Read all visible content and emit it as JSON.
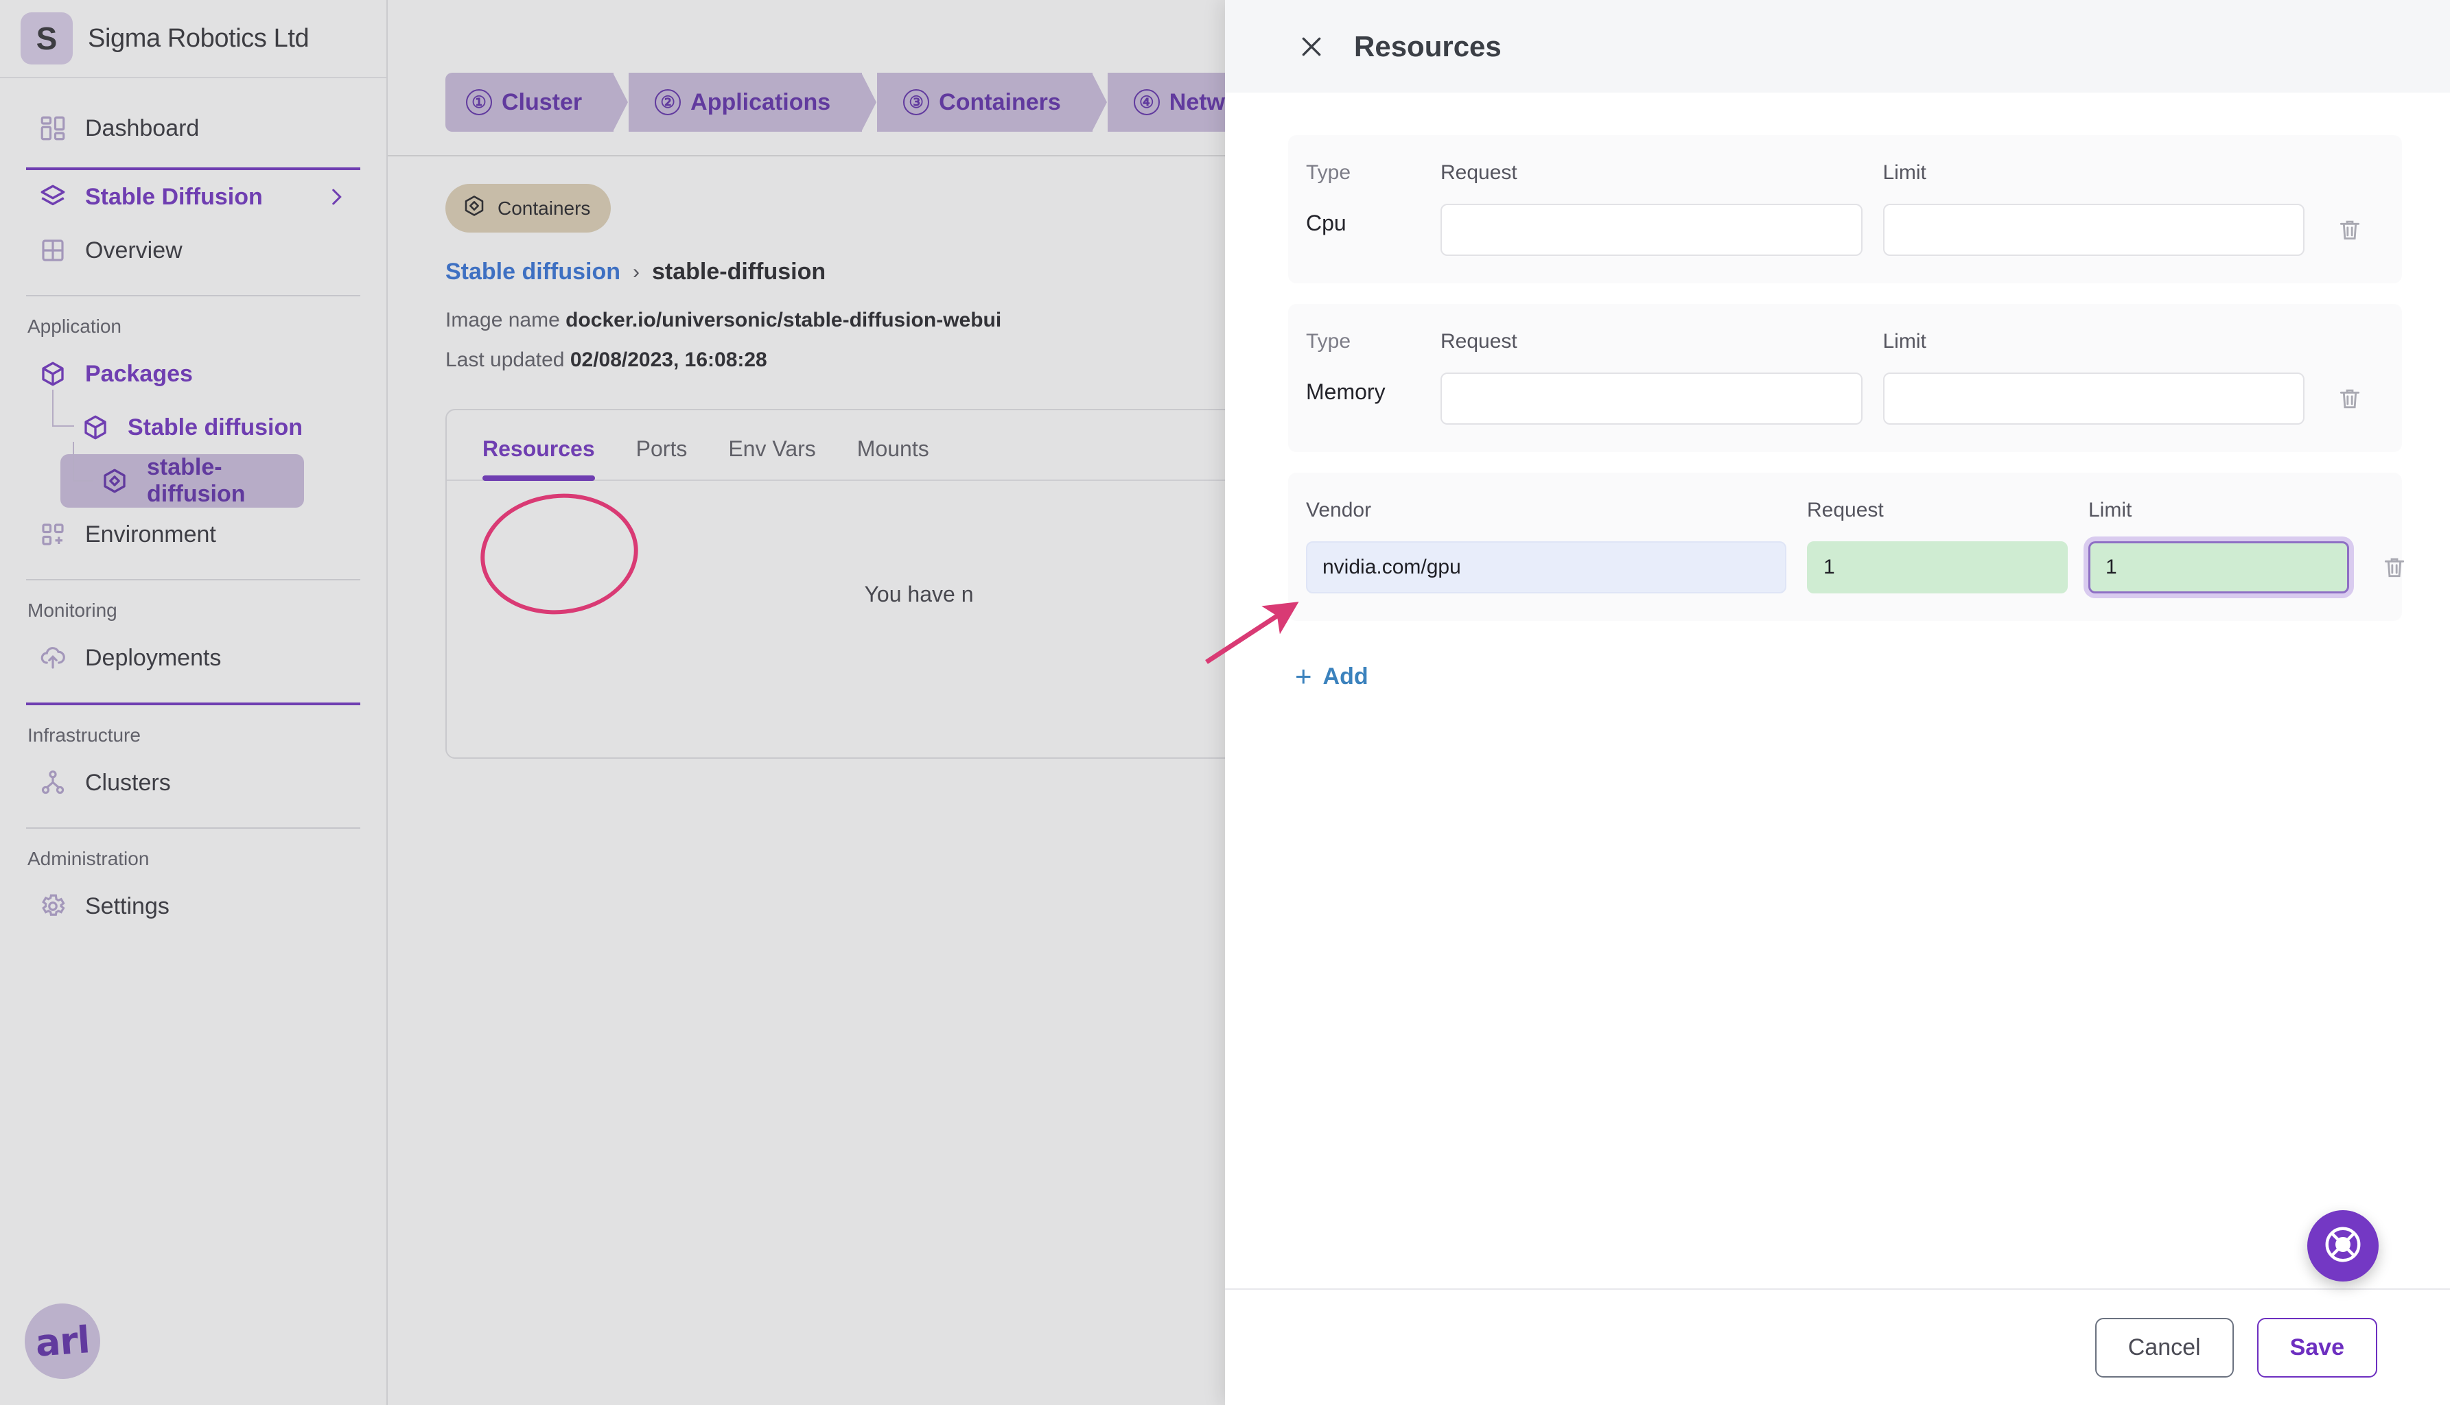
{
  "brand": {
    "badge_letter": "S",
    "name": "Sigma Robotics Ltd"
  },
  "sidebar": {
    "top_items": [
      {
        "label": "Dashboard",
        "icon": "dashboard-icon"
      }
    ],
    "context": {
      "label": "Stable Diffusion",
      "icon": "layers-icon",
      "chevron": "chevron-right-icon"
    },
    "overview": {
      "label": "Overview",
      "icon": "grid-icon"
    },
    "groups": [
      {
        "title": "Application",
        "items": [
          {
            "label": "Packages",
            "icon": "package-icon"
          },
          {
            "label": "Stable diffusion",
            "icon": "package-icon"
          },
          {
            "label": "stable-diffusion",
            "icon": "container-icon"
          },
          {
            "label": "Environment",
            "icon": "environment-icon"
          }
        ]
      },
      {
        "title": "Monitoring",
        "items": [
          {
            "label": "Deployments",
            "icon": "cloud-upload-icon"
          }
        ]
      },
      {
        "title": "Infrastructure",
        "items": [
          {
            "label": "Clusters",
            "icon": "cluster-icon"
          }
        ]
      },
      {
        "title": "Administration",
        "items": [
          {
            "label": "Settings",
            "icon": "gear-icon"
          }
        ]
      }
    ],
    "org_logo_text": "arl"
  },
  "stepper": [
    {
      "num": "①",
      "label": "Cluster"
    },
    {
      "num": "②",
      "label": "Applications"
    },
    {
      "num": "③",
      "label": "Containers"
    },
    {
      "num": "④",
      "label": "Netw"
    }
  ],
  "main": {
    "chip": {
      "label": "Containers",
      "icon": "container-icon"
    },
    "breadcrumb": {
      "parent": "Stable diffusion",
      "separator": "›",
      "current": "stable-diffusion"
    },
    "image_name_label": "Image name",
    "image_name_value": "docker.io/universonic/stable-diffusion-webui",
    "last_updated_label": "Last updated",
    "last_updated_value": "02/08/2023, 16:08:28",
    "tabs": [
      {
        "label": "Resources",
        "active": true
      },
      {
        "label": "Ports",
        "active": false
      },
      {
        "label": "Env Vars",
        "active": false
      },
      {
        "label": "Mounts",
        "active": false
      }
    ],
    "empty_text": "You have n"
  },
  "drawer": {
    "close_icon": "close-icon",
    "title": "Resources",
    "cards": [
      {
        "col1_header": "Type",
        "col2_header": "Request",
        "col3_header": "Limit",
        "type_value": "Cpu",
        "request_value": "",
        "limit_value": "",
        "delete_icon": "trash-icon"
      },
      {
        "col1_header": "Type",
        "col2_header": "Request",
        "col3_header": "Limit",
        "type_value": "Memory",
        "request_value": "",
        "limit_value": "",
        "delete_icon": "trash-icon"
      }
    ],
    "gpu_card": {
      "col1_header": "Vendor",
      "col2_header": "Request",
      "col3_header": "Limit",
      "vendor_value": "nvidia.com/gpu",
      "request_value": "1",
      "limit_value": "1",
      "delete_icon": "trash-icon"
    },
    "add_label": "Add",
    "add_plus": "+",
    "cancel_label": "Cancel",
    "save_label": "Save"
  },
  "fab": {
    "icon": "lifebuoy-icon"
  },
  "colors": {
    "accent_purple": "#6d2fc0",
    "step_bg": "#c9bcdd",
    "link_blue": "#2f6fd6",
    "chip_bg": "#ded0b5",
    "annotation_pink": "#d93a74",
    "field_green": "#cfecd2",
    "field_blue": "#e8edfa",
    "add_blue": "#3b82bd"
  }
}
